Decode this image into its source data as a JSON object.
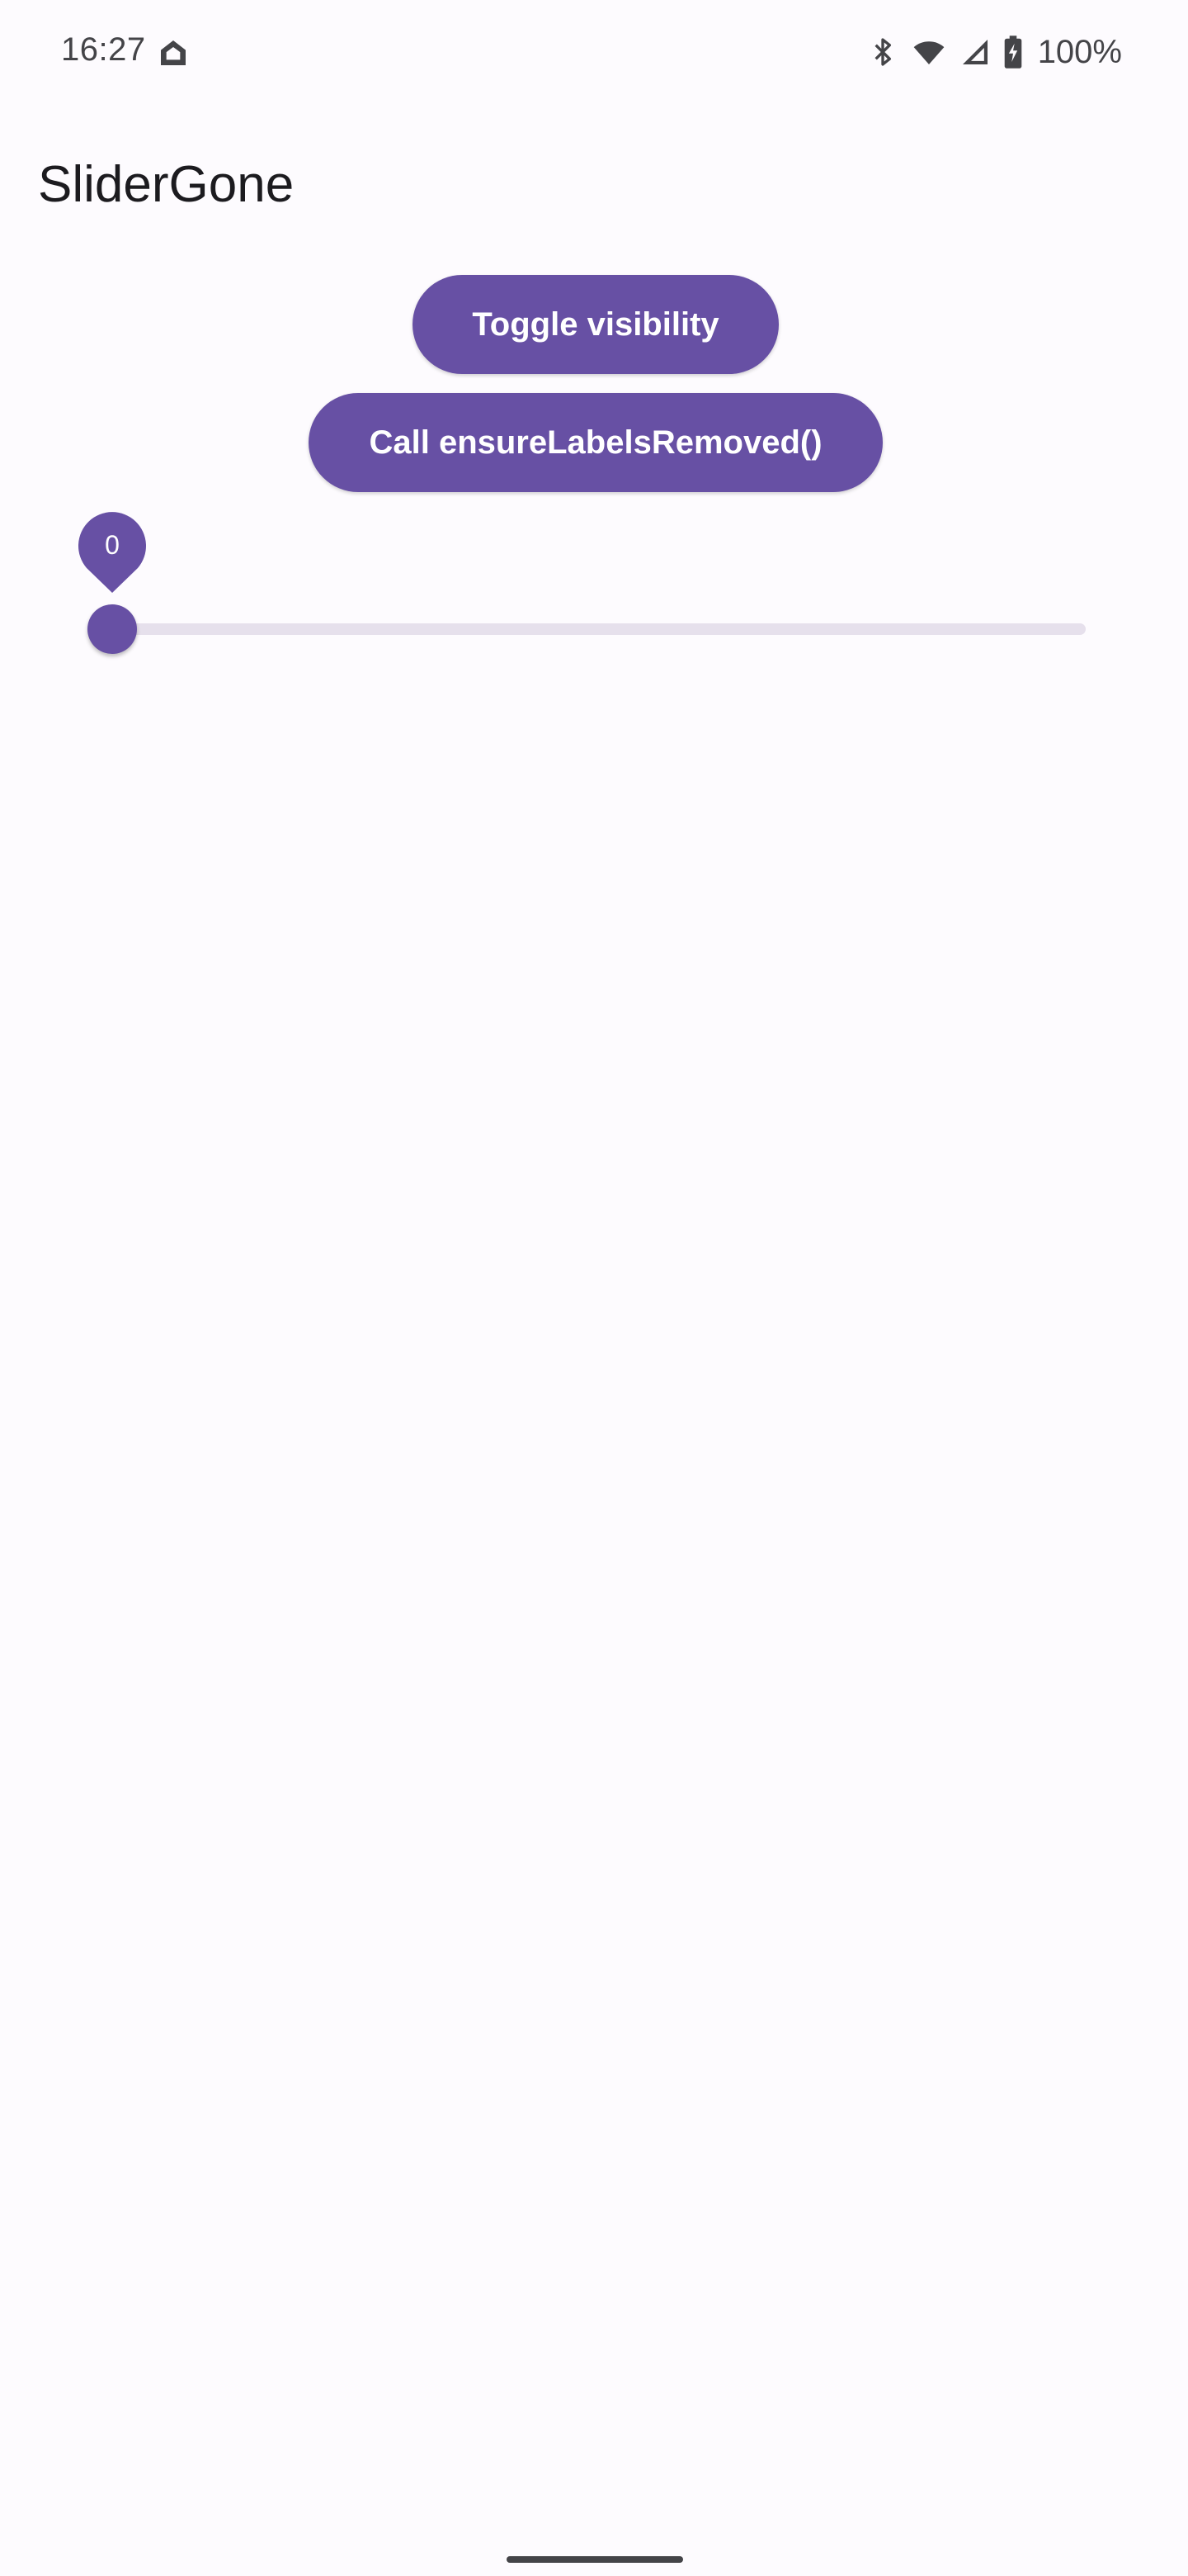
{
  "status_bar": {
    "time": "16:27",
    "battery_percent": "100%",
    "icons": [
      "home-icon",
      "bluetooth-icon",
      "wifi-icon",
      "cell-signal-icon",
      "battery-charging-icon"
    ]
  },
  "app": {
    "title": "SliderGone"
  },
  "buttons": {
    "toggle_label": "Toggle visibility",
    "ensure_label": "Call ensureLabelsRemoved()"
  },
  "slider": {
    "value": 0,
    "label": "0"
  },
  "colors": {
    "primary": "#6750a4",
    "background": "#fdfbfe",
    "track_inactive": "#e6e0ec",
    "on_primary": "#ffffff"
  }
}
